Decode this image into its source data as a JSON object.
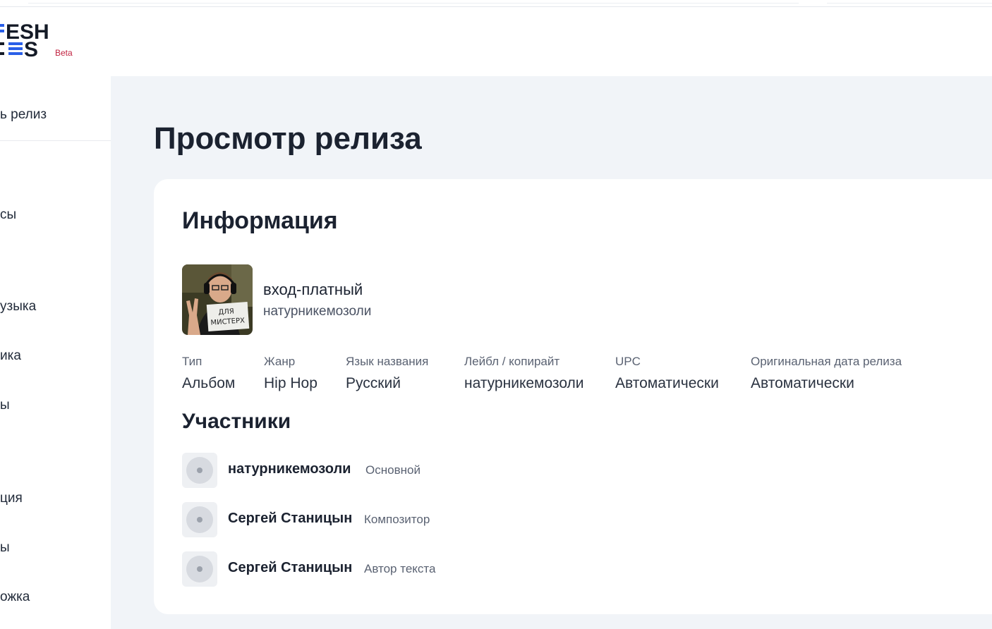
{
  "logo": {
    "line1": "ESH",
    "line2": "S",
    "badge": "Beta",
    "accent_color": "#2a5fe8"
  },
  "sidebar": {
    "items": [
      {
        "label": "ь релиз"
      },
      {
        "label": "сы"
      },
      {
        "label": "узыка"
      },
      {
        "label": "ика"
      },
      {
        "label": "ы"
      },
      {
        "label": "ция"
      },
      {
        "label": "ы"
      },
      {
        "label": "ожка"
      }
    ]
  },
  "page": {
    "title": "Просмотр релиза"
  },
  "info": {
    "section_title": "Информация",
    "cover_icon": "album-cover-image",
    "release_name": "вход-платный",
    "release_artist": "натурникемозоли",
    "meta": [
      {
        "label": "Тип",
        "value": "Альбом"
      },
      {
        "label": "Жанр",
        "value": "Hip Hop"
      },
      {
        "label": "Язык названия",
        "value": "Русский"
      },
      {
        "label": "Лейбл / копирайт",
        "value": "натурникемозоли"
      },
      {
        "label": "UPC",
        "value": "Автоматически"
      },
      {
        "label": "Оригинальная дата релиза",
        "value": "Автоматически"
      }
    ]
  },
  "participants": {
    "section_title": "Участники",
    "avatar_icon": "placeholder-avatar-icon",
    "items": [
      {
        "name": "натурникемозоли",
        "role": "Основной"
      },
      {
        "name": "Сергей Станицын",
        "role": "Композитор"
      },
      {
        "name": "Сергей Станицын",
        "role": "Автор текста"
      }
    ]
  }
}
